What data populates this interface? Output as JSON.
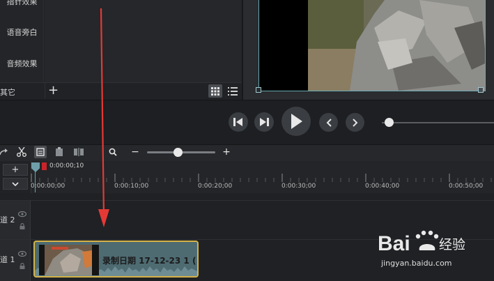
{
  "sidebar": {
    "items": [
      {
        "label": "指针效果"
      },
      {
        "label": "语音旁白"
      },
      {
        "label": "音频效果"
      }
    ],
    "more_label": "其它",
    "add_label": "+"
  },
  "playback": {
    "buttons": [
      "step-back",
      "step-forward",
      "play",
      "previous",
      "next"
    ]
  },
  "toolbar": {
    "zoom_minus": "−",
    "zoom_plus": "+",
    "zoom_level": 0.45
  },
  "timeline": {
    "add_track": "+",
    "collapse": "⌄",
    "playhead_time": "0:00:00;10",
    "ticks": [
      "0:00:00;00",
      "0:00:10;00",
      "0:00:20;00",
      "0:00:30;00",
      "0:00:40;00",
      "0:00:50;00"
    ],
    "tracks": [
      {
        "name": "道 2"
      },
      {
        "name": "道 1"
      }
    ],
    "clip_title": "录制日期 17-12-23 1 ("
  },
  "watermark": {
    "brand_text": "Bai",
    "brand_suffix": "经验",
    "url": "jingyan.baidu.com"
  },
  "colors": {
    "accent": "#6aa8b3",
    "clip_border": "#d4b246",
    "annotation_arrow": "#e53935"
  }
}
